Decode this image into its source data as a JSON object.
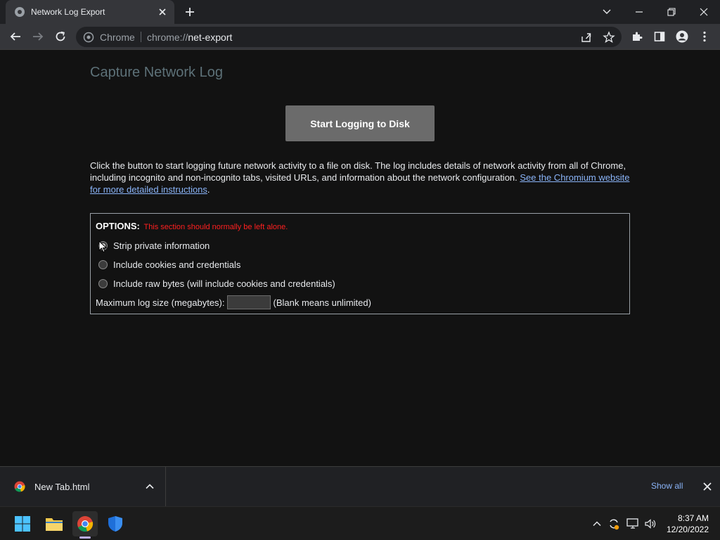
{
  "browser": {
    "tab_title": "Network Log Export",
    "omnibox_chip": "Chrome",
    "url_scheme": "chrome://",
    "url_path": "net-export"
  },
  "page": {
    "title": "Capture Network Log",
    "start_button": "Start Logging to Disk",
    "description": "Click the button to start logging future network activity to a file on disk. The log includes details of network activity from all of Chrome, including incognito and non-incognito tabs, visited URLs, and information about the network configuration. ",
    "link_text": "See the Chromium website for more detailed instructions",
    "description_end": ".",
    "options": {
      "heading": "OPTIONS:",
      "warning": "This section should normally be left alone.",
      "radios": [
        {
          "label": "Strip private information",
          "checked": true
        },
        {
          "label": "Include cookies and credentials",
          "checked": false
        },
        {
          "label": "Include raw bytes (will include cookies and credentials)",
          "checked": false
        }
      ],
      "max_size_label": "Maximum log size (megabytes):",
      "max_size_value": "",
      "max_size_hint": "(Blank means unlimited)"
    }
  },
  "download_shelf": {
    "file_name": "New Tab.html",
    "show_all": "Show all"
  },
  "taskbar": {
    "time": "8:37 AM",
    "date": "12/20/2022"
  },
  "colors": {
    "accent": "#8ab4f8",
    "warning": "#ff2020",
    "title": "#5d7178"
  }
}
